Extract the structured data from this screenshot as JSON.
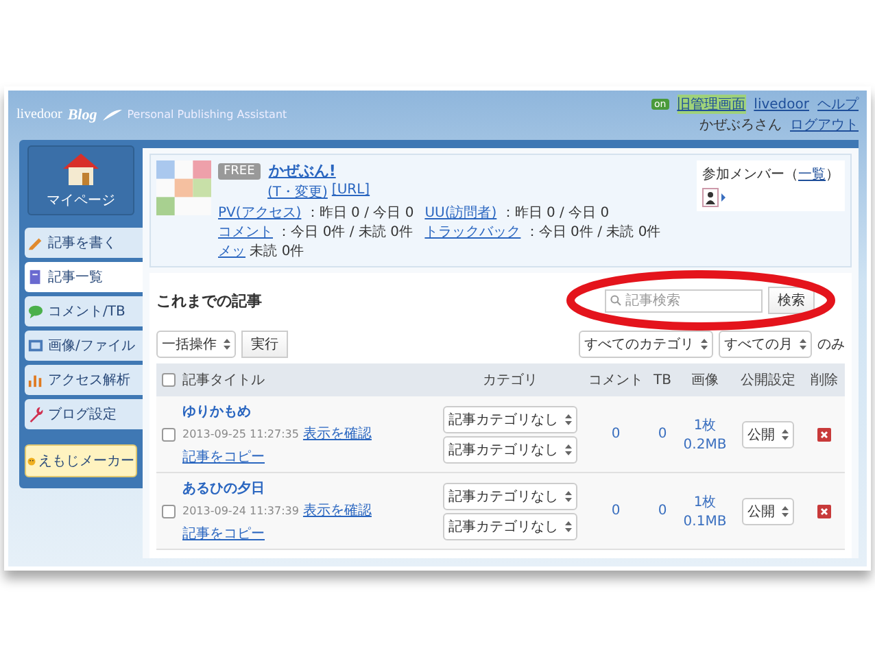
{
  "header": {
    "brand": "livedoor",
    "logo": "Blog",
    "tagline": "Personal Publishing Assistant",
    "badge": "on",
    "links": [
      "旧管理画面",
      "livedoor",
      "ヘルプ"
    ],
    "user": "かぜぶろさん",
    "logout": "ログアウト"
  },
  "sidebar": {
    "home": "マイページ",
    "items": [
      {
        "label": "記事を書く",
        "selected": false,
        "kind": "pencil"
      },
      {
        "label": "記事一覧",
        "selected": true,
        "kind": "page"
      },
      {
        "label": "コメント/TB",
        "selected": false,
        "kind": "bubble"
      },
      {
        "label": "画像/ファイル",
        "selected": false,
        "kind": "image"
      },
      {
        "label": "アクセス解析",
        "selected": false,
        "kind": "chart"
      },
      {
        "label": "ブログ設定",
        "selected": false,
        "kind": "wrench"
      }
    ],
    "extra": "えもじメーカー"
  },
  "blog": {
    "plan": "FREE",
    "name": "かぜぶん!",
    "links": [
      "(T・変更)",
      "[URL]"
    ],
    "stats": [
      {
        "label": "PV(アクセス)",
        "value": "：昨日 0 / 今日 0"
      },
      {
        "label": "UU(訪問者)",
        "value": "：昨日 0 / 今日 0"
      },
      {
        "label": "コメント",
        "value": "：今日 0件 / 未読 0件"
      },
      {
        "label": "トラックバック",
        "value": "：今日 0件 / 未読 0件"
      },
      {
        "label": "メッ",
        "value": "未読 0件"
      }
    ],
    "members": {
      "label": "参加メンバー（",
      "link": "一覧",
      "end": "）"
    }
  },
  "articles": {
    "title": "これまでの記事",
    "search": {
      "placeholder": "記事検索",
      "button": "検索"
    },
    "bulk": {
      "select": "一括操作",
      "button": "実行"
    },
    "filters": [
      "すべてのカテゴリ",
      "すべての月"
    ],
    "filter_note": "のみ",
    "select_all_checked": false,
    "columns": [
      "記事タイトル",
      "カテゴリ",
      "コメント",
      "TB",
      "画像",
      "公開設定",
      "削除"
    ],
    "rows": [
      {
        "checked": false,
        "title": "ゆりかもめ",
        "date": "2013-09-25 11:27:35",
        "links": [
          "表示を確認",
          "記事をコピー"
        ],
        "categories": [
          "記事カテゴリなし",
          "記事カテゴリなし"
        ],
        "comments": "0",
        "tb": "0",
        "images": "1枚",
        "size": "0.2MB",
        "status": "公開"
      },
      {
        "checked": false,
        "title": "あるひの夕日",
        "date": "2013-09-24 11:37:39",
        "links": [
          "表示を確認",
          "記事をコピー"
        ],
        "categories": [
          "記事カテゴリなし",
          "記事カテゴリなし"
        ],
        "comments": "0",
        "tb": "0",
        "images": "1枚",
        "size": "0.1MB",
        "status": "公開"
      }
    ]
  }
}
